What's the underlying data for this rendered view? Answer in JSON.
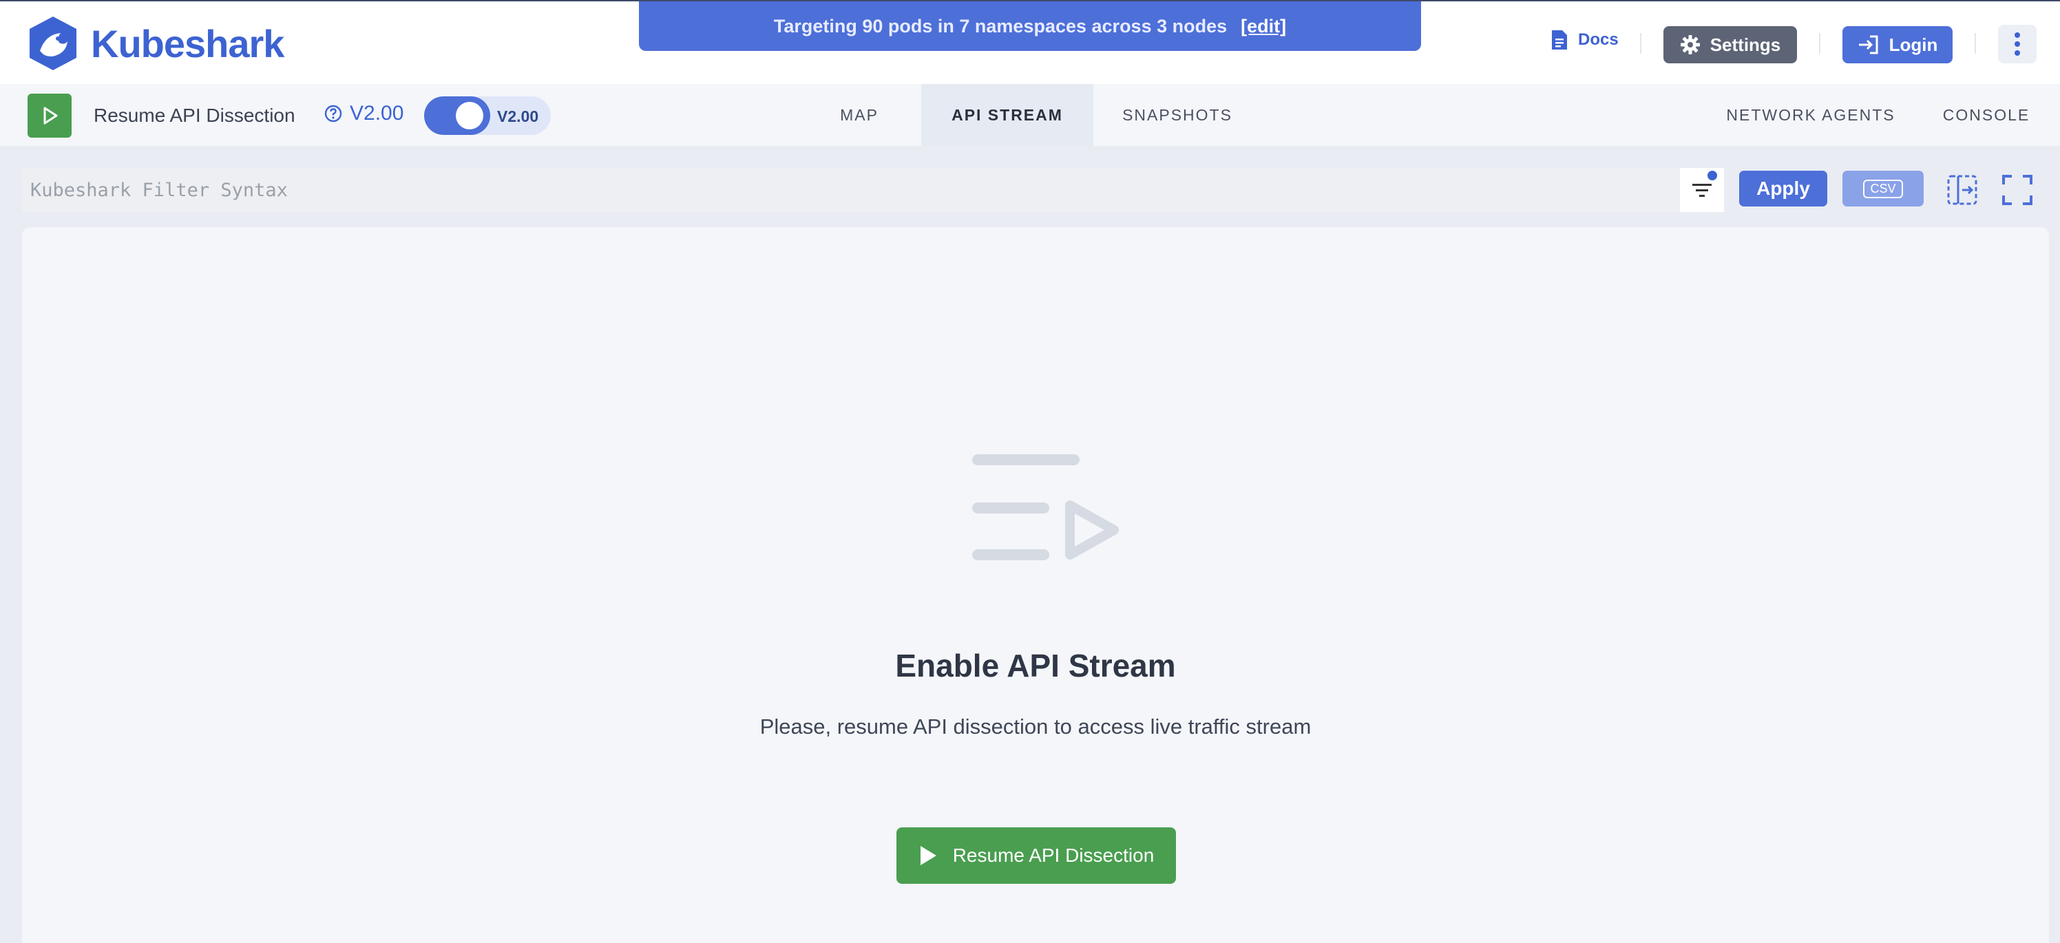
{
  "app": {
    "name": "Kubeshark"
  },
  "banner": {
    "text": "Targeting 90 pods in 7 namespaces across 3 nodes",
    "edit_label": "[edit]"
  },
  "header": {
    "docs_label": "Docs",
    "settings_label": "Settings",
    "login_label": "Login"
  },
  "subbar": {
    "resume_label": "Resume API Dissection",
    "version_label": "V2.00",
    "toggle_label": "V2.00",
    "tabs": [
      {
        "label": "MAP",
        "active": false
      },
      {
        "label": "API STREAM",
        "active": true
      },
      {
        "label": "SNAPSHOTS",
        "active": false
      }
    ],
    "right_tabs": [
      {
        "label": "NETWORK AGENTS"
      },
      {
        "label": "CONSOLE"
      }
    ]
  },
  "filter": {
    "placeholder": "Kubeshark Filter Syntax",
    "value": "",
    "apply_label": "Apply",
    "csv_label": "CSV"
  },
  "empty_state": {
    "title": "Enable API Stream",
    "subtitle": "Please, resume API dissection to access live traffic stream",
    "button_label": "Resume API Dissection"
  },
  "colors": {
    "accent": "#4d6fd8",
    "brand": "#3d63d2",
    "success": "#4a9e50",
    "settings_bg": "#5d6475"
  },
  "icons": [
    "kubeshark-logo-icon",
    "document-icon",
    "gear-icon",
    "login-icon",
    "more-vertical-icon",
    "play-icon",
    "help-circle-icon",
    "filter-icon",
    "csv-icon",
    "split-view-icon",
    "fullscreen-icon",
    "stream-empty-icon"
  ]
}
